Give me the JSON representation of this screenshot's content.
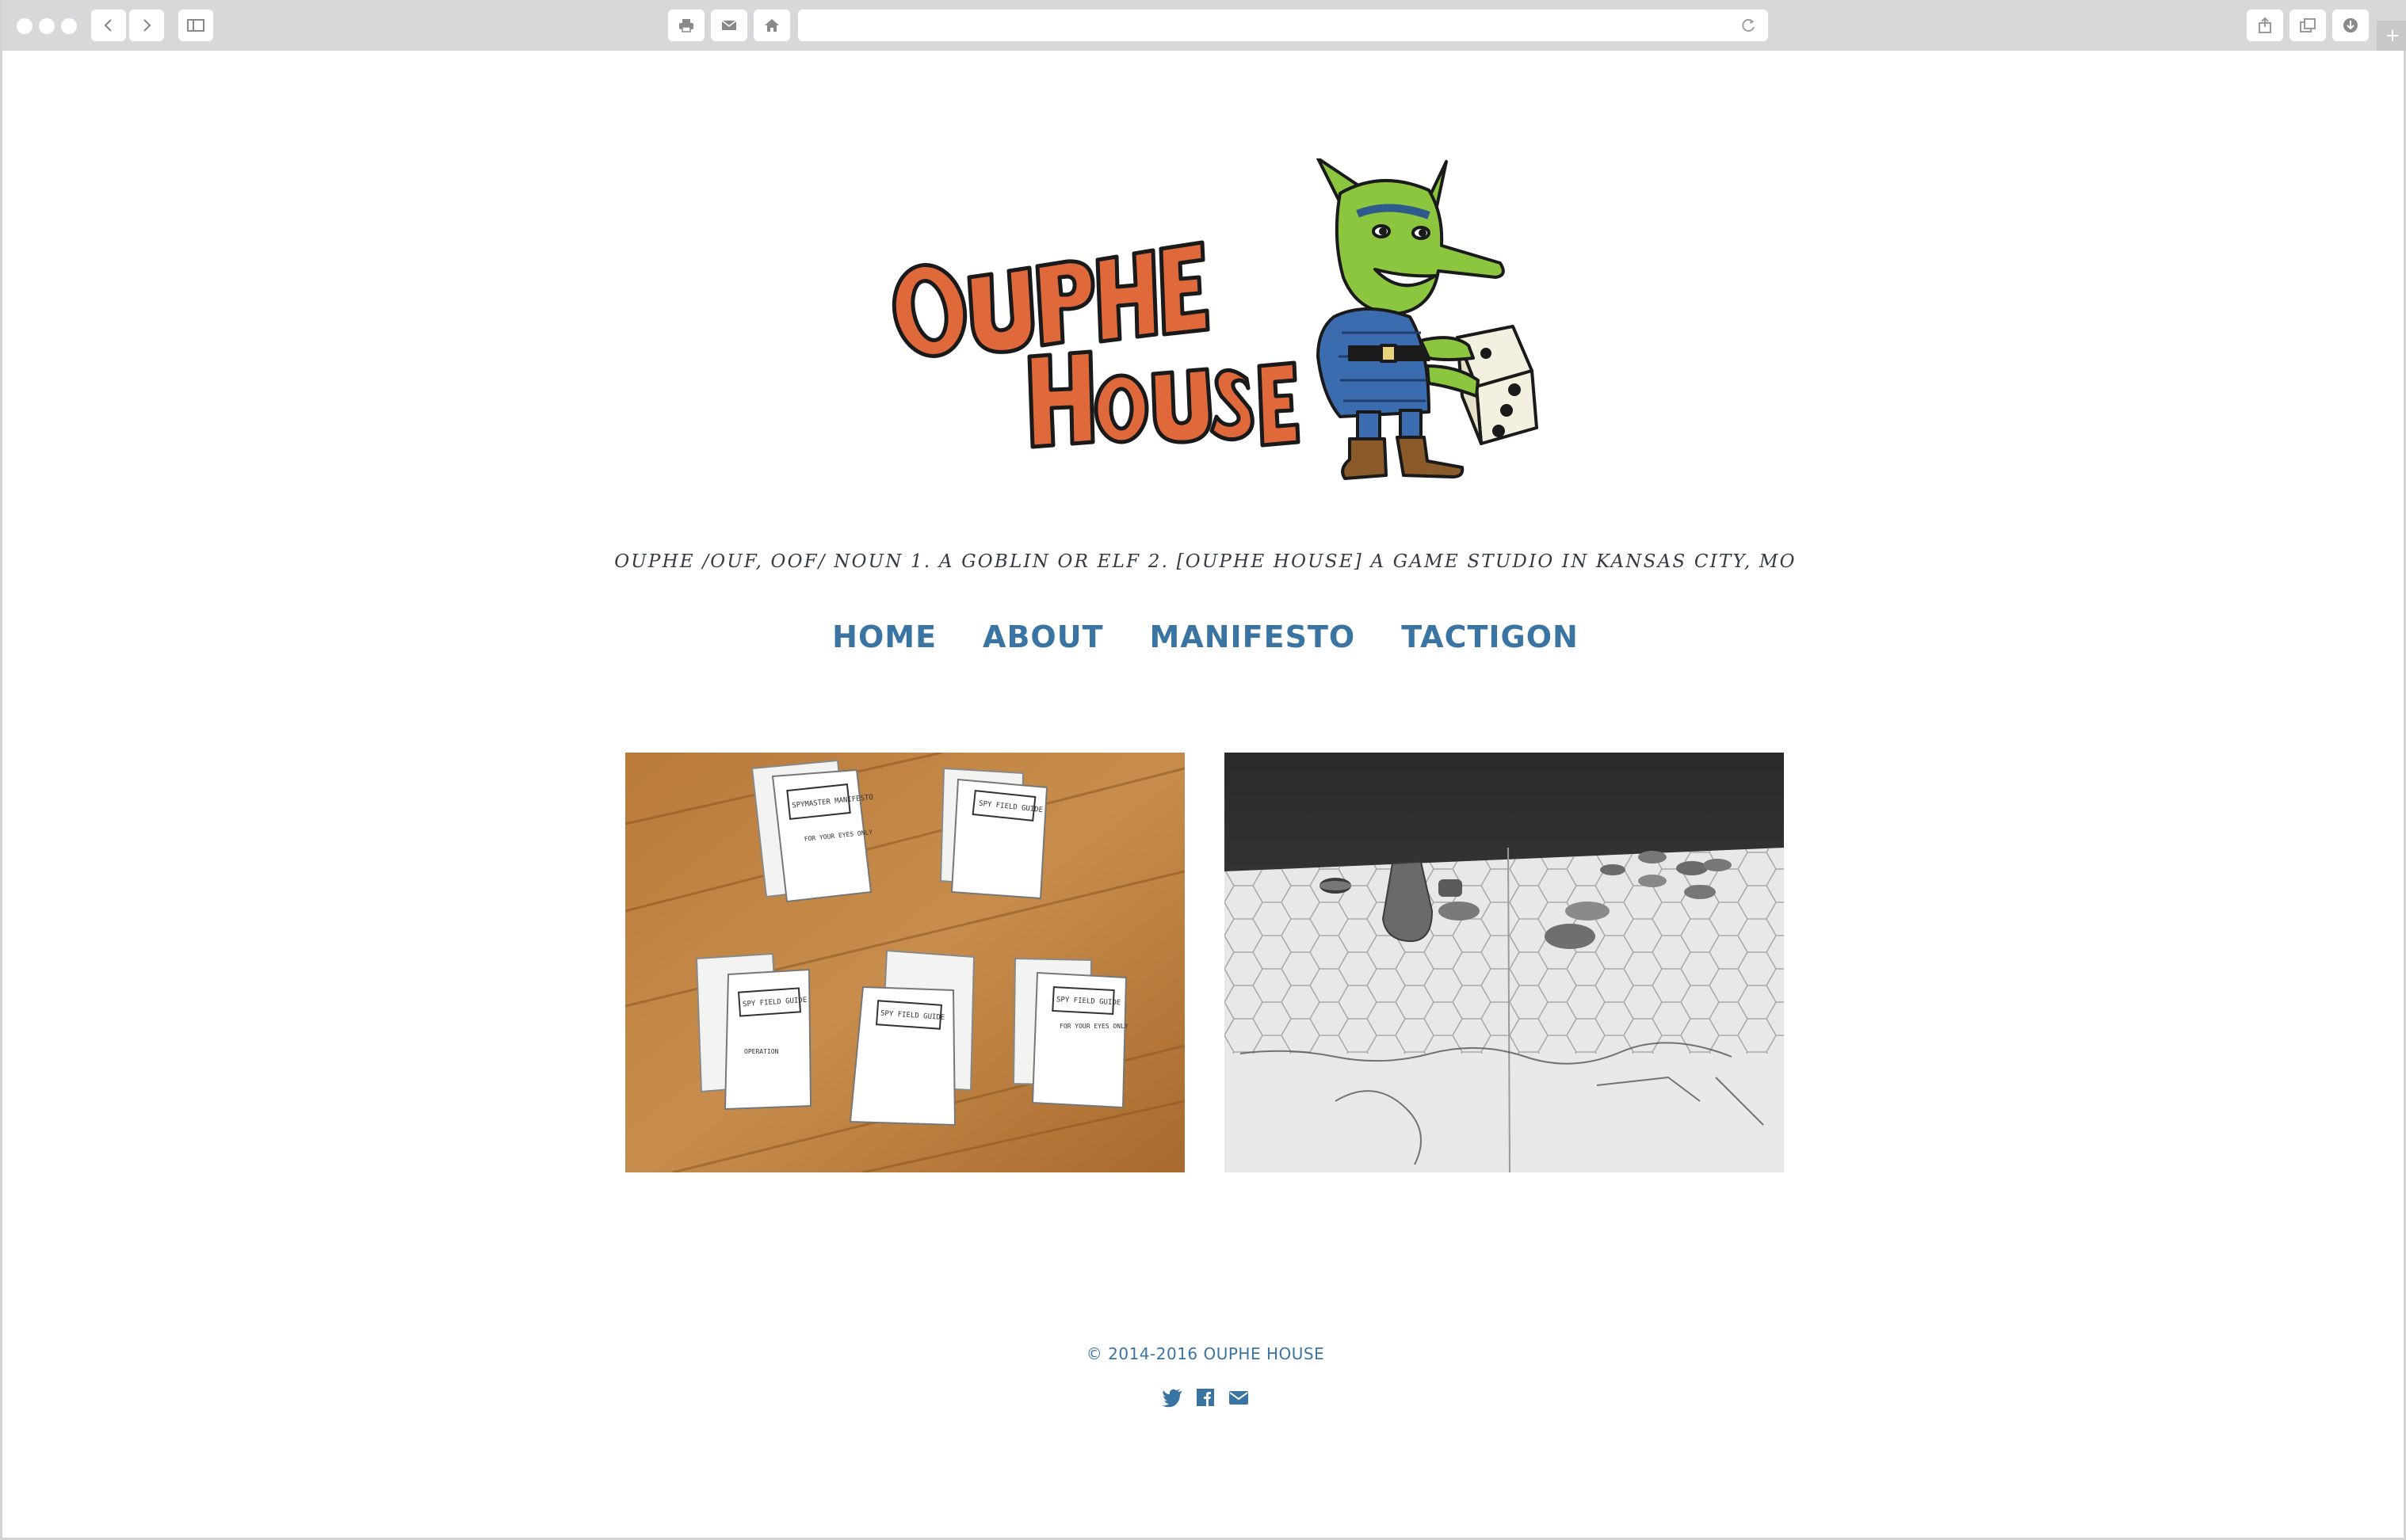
{
  "browser": {
    "url": ""
  },
  "site": {
    "brand": "OUPHE HOUSE",
    "tagline": "OUPHE /OUF, OOF/ NOUN 1. A GOBLIN OR ELF 2. [OUPHE HOUSE] A GAME STUDIO IN KANSAS CITY, MO",
    "logo_icon": "goblin-holding-die",
    "colors": {
      "accent": "#3a74a3",
      "logo_orange": "#e0693c",
      "goblin_green": "#8cc63f",
      "armor_blue": "#3b6cb0"
    }
  },
  "nav": {
    "items": [
      {
        "label": "HOME"
      },
      {
        "label": "ABOUT"
      },
      {
        "label": "MANIFESTO"
      },
      {
        "label": "TACTIGON"
      }
    ]
  },
  "gallery": {
    "items": [
      {
        "name": "spy-field-guide-booklets-photo",
        "booklet_texts": [
          "SPY FIELD GUIDE",
          "SPYMASTER MANIFESTO",
          "FOR YOUR EYES ONLY",
          "OPERATION"
        ]
      },
      {
        "name": "tactigon-hex-board-photo"
      }
    ]
  },
  "footer": {
    "copyright": "© 2014-2016 OUPHE HOUSE",
    "social_icons": [
      "twitter-icon",
      "facebook-icon",
      "email-icon"
    ]
  }
}
